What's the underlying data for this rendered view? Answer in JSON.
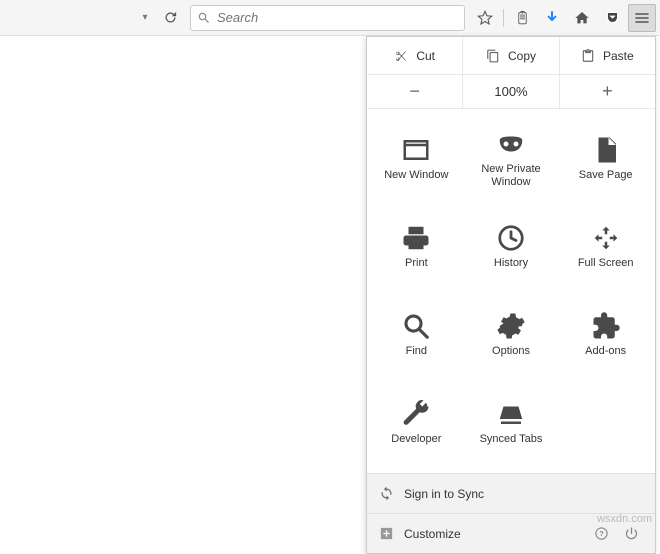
{
  "toolbar": {
    "search_placeholder": "Search"
  },
  "edit": {
    "cut": "Cut",
    "copy": "Copy",
    "paste": "Paste"
  },
  "zoom": {
    "level": "100%"
  },
  "grid": {
    "new_window": "New Window",
    "new_private": "New Private\nWindow",
    "save_page": "Save Page",
    "print": "Print",
    "history": "History",
    "full_screen": "Full Screen",
    "find": "Find",
    "options": "Options",
    "addons": "Add-ons",
    "developer": "Developer",
    "synced_tabs": "Synced Tabs"
  },
  "footer": {
    "sign_in": "Sign in to Sync",
    "customize": "Customize"
  },
  "watermark": "wsxdn.com"
}
